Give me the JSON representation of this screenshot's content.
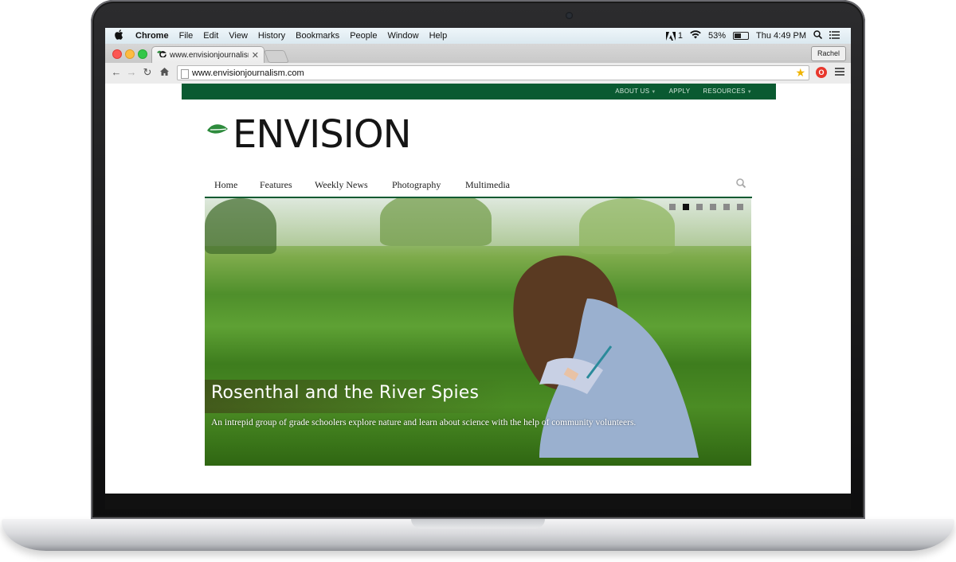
{
  "menubar": {
    "app_name": "Chrome",
    "menus": [
      "File",
      "Edit",
      "View",
      "History",
      "Bookmarks",
      "People",
      "Window",
      "Help"
    ],
    "adobe_count": "1",
    "battery": "53%",
    "battery_level": 0.53,
    "clock": "Thu 4:49 PM"
  },
  "browser": {
    "tab_title": "www.envisionjournalism.co",
    "profile_name": "Rachel",
    "url": "www.envisionjournalism.com"
  },
  "site": {
    "top_links": [
      "ABOUT US",
      "APPLY",
      "RESOURCES"
    ],
    "logo_text": "ENVISION",
    "nav": [
      "Home",
      "Features",
      "Weekly News",
      "Photography",
      "Multimedia"
    ],
    "slide_count": 6,
    "active_slide": 2,
    "slide": {
      "title": "Rosenthal and the River Spies",
      "subtitle": "An intrepid group of grade schoolers explore nature and learn about science with the help of community volunteers."
    }
  },
  "colors": {
    "brand_green": "#0a5a31",
    "leaf_green": "#2e8b3d"
  }
}
